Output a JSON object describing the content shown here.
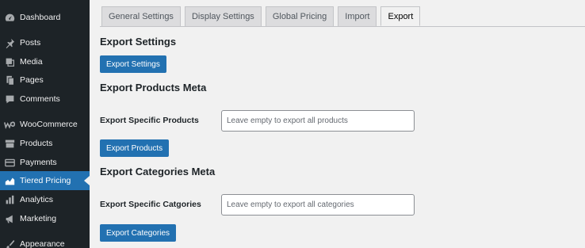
{
  "sidebar": {
    "items": [
      {
        "label": "Dashboard",
        "icon": "dashboard-icon"
      },
      {
        "label": "Posts",
        "icon": "pin-icon"
      },
      {
        "label": "Media",
        "icon": "media-icon"
      },
      {
        "label": "Pages",
        "icon": "pages-icon"
      },
      {
        "label": "Comments",
        "icon": "comment-icon"
      },
      {
        "label": "WooCommerce",
        "icon": "woocommerce-icon"
      },
      {
        "label": "Products",
        "icon": "archive-icon"
      },
      {
        "label": "Payments",
        "icon": "card-icon"
      },
      {
        "label": "Tiered Pricing",
        "icon": "chart-area-icon",
        "active": true
      },
      {
        "label": "Analytics",
        "icon": "bar-chart-icon"
      },
      {
        "label": "Marketing",
        "icon": "megaphone-icon"
      },
      {
        "label": "Appearance",
        "icon": "brush-icon"
      }
    ]
  },
  "tabs": [
    {
      "label": "General Settings"
    },
    {
      "label": "Display Settings"
    },
    {
      "label": "Global Pricing"
    },
    {
      "label": "Import"
    },
    {
      "label": "Export",
      "active": true
    }
  ],
  "export_settings": {
    "heading": "Export Settings",
    "button": "Export Settings"
  },
  "products_meta": {
    "heading": "Export Products Meta",
    "label": "Export Specific Products",
    "placeholder": "Leave empty to export all products",
    "value": "",
    "button": "Export Products"
  },
  "categories_meta": {
    "heading": "Export Categories Meta",
    "label": "Export Specific Catgories",
    "placeholder": "Leave empty to export all categories",
    "value": "",
    "button": "Export Categories"
  },
  "colors": {
    "sidebar_bg": "#1d2327",
    "accent": "#2271b1",
    "page_bg": "#f1f1f1"
  }
}
